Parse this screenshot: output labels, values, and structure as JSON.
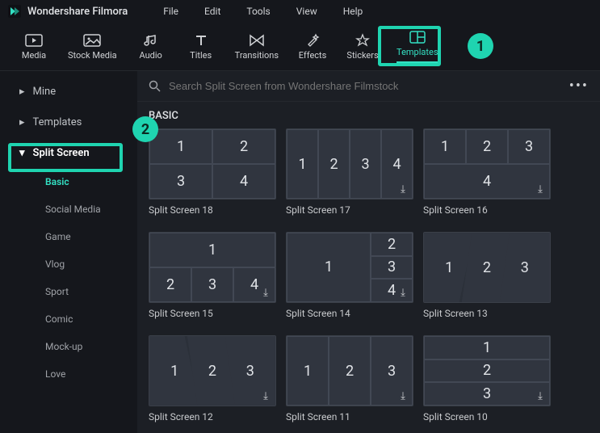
{
  "app": {
    "title": "Wondershare Filmora"
  },
  "menus": [
    "File",
    "Edit",
    "Tools",
    "View",
    "Help"
  ],
  "toolbar": [
    {
      "id": "media",
      "label": "Media"
    },
    {
      "id": "stock-media",
      "label": "Stock Media"
    },
    {
      "id": "audio",
      "label": "Audio"
    },
    {
      "id": "titles",
      "label": "Titles"
    },
    {
      "id": "transitions",
      "label": "Transitions"
    },
    {
      "id": "effects",
      "label": "Effects"
    },
    {
      "id": "stickers",
      "label": "Stickers"
    },
    {
      "id": "templates",
      "label": "Templates"
    }
  ],
  "sidebar": {
    "items": [
      {
        "label": "Mine"
      },
      {
        "label": "Templates"
      },
      {
        "label": "Split Screen"
      }
    ],
    "subs": [
      "Basic",
      "Social Media",
      "Game",
      "Vlog",
      "Sport",
      "Comic",
      "Mock-up",
      "Love"
    ]
  },
  "search": {
    "placeholder": "Search Split Screen from Wondershare Filmstock"
  },
  "heading": "BASIC",
  "cards": [
    {
      "label": "Split Screen 18"
    },
    {
      "label": "Split Screen 17"
    },
    {
      "label": "Split Screen 16"
    },
    {
      "label": "Split Screen 15"
    },
    {
      "label": "Split Screen 14"
    },
    {
      "label": "Split Screen 13"
    },
    {
      "label": "Split Screen 12"
    },
    {
      "label": "Split Screen 11"
    },
    {
      "label": "Split Screen 10"
    }
  ],
  "annotations": {
    "1": "1",
    "2": "2"
  }
}
